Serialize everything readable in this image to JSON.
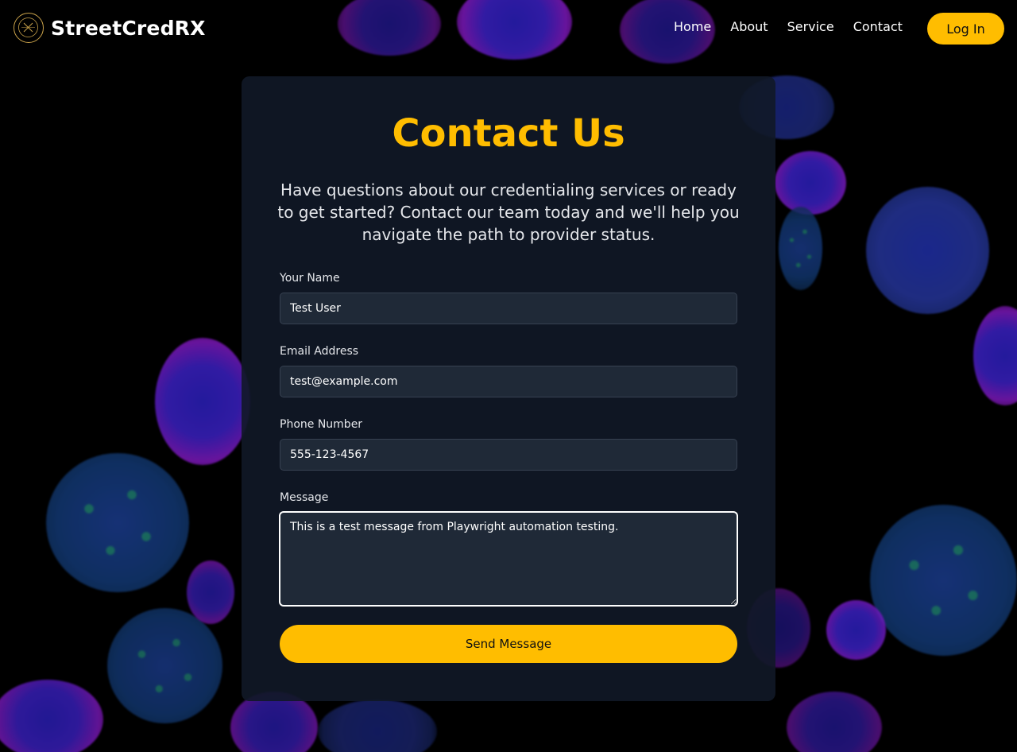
{
  "header": {
    "brand": "StreetCredRX",
    "nav": [
      "Home",
      "About",
      "Service",
      "Contact"
    ],
    "login_label": "Log In"
  },
  "contact": {
    "title": "Contact Us",
    "intro": "Have questions about our credentialing services or ready to get started? Contact our team today and we'll help you navigate the path to provider status.",
    "fields": {
      "name": {
        "label": "Your Name",
        "value": "Test User"
      },
      "email": {
        "label": "Email Address",
        "value": "test@example.com"
      },
      "phone": {
        "label": "Phone Number",
        "value": "555-123-4567"
      },
      "message": {
        "label": "Message",
        "value": "This is a test message from Playwright automation testing."
      }
    },
    "submit_label": "Send Message"
  },
  "colors": {
    "accent": "#ffbd00",
    "card": "#111827",
    "input": "#1f2937",
    "background": "#000000"
  },
  "icons": {
    "logo": "compass-emblem-icon"
  }
}
